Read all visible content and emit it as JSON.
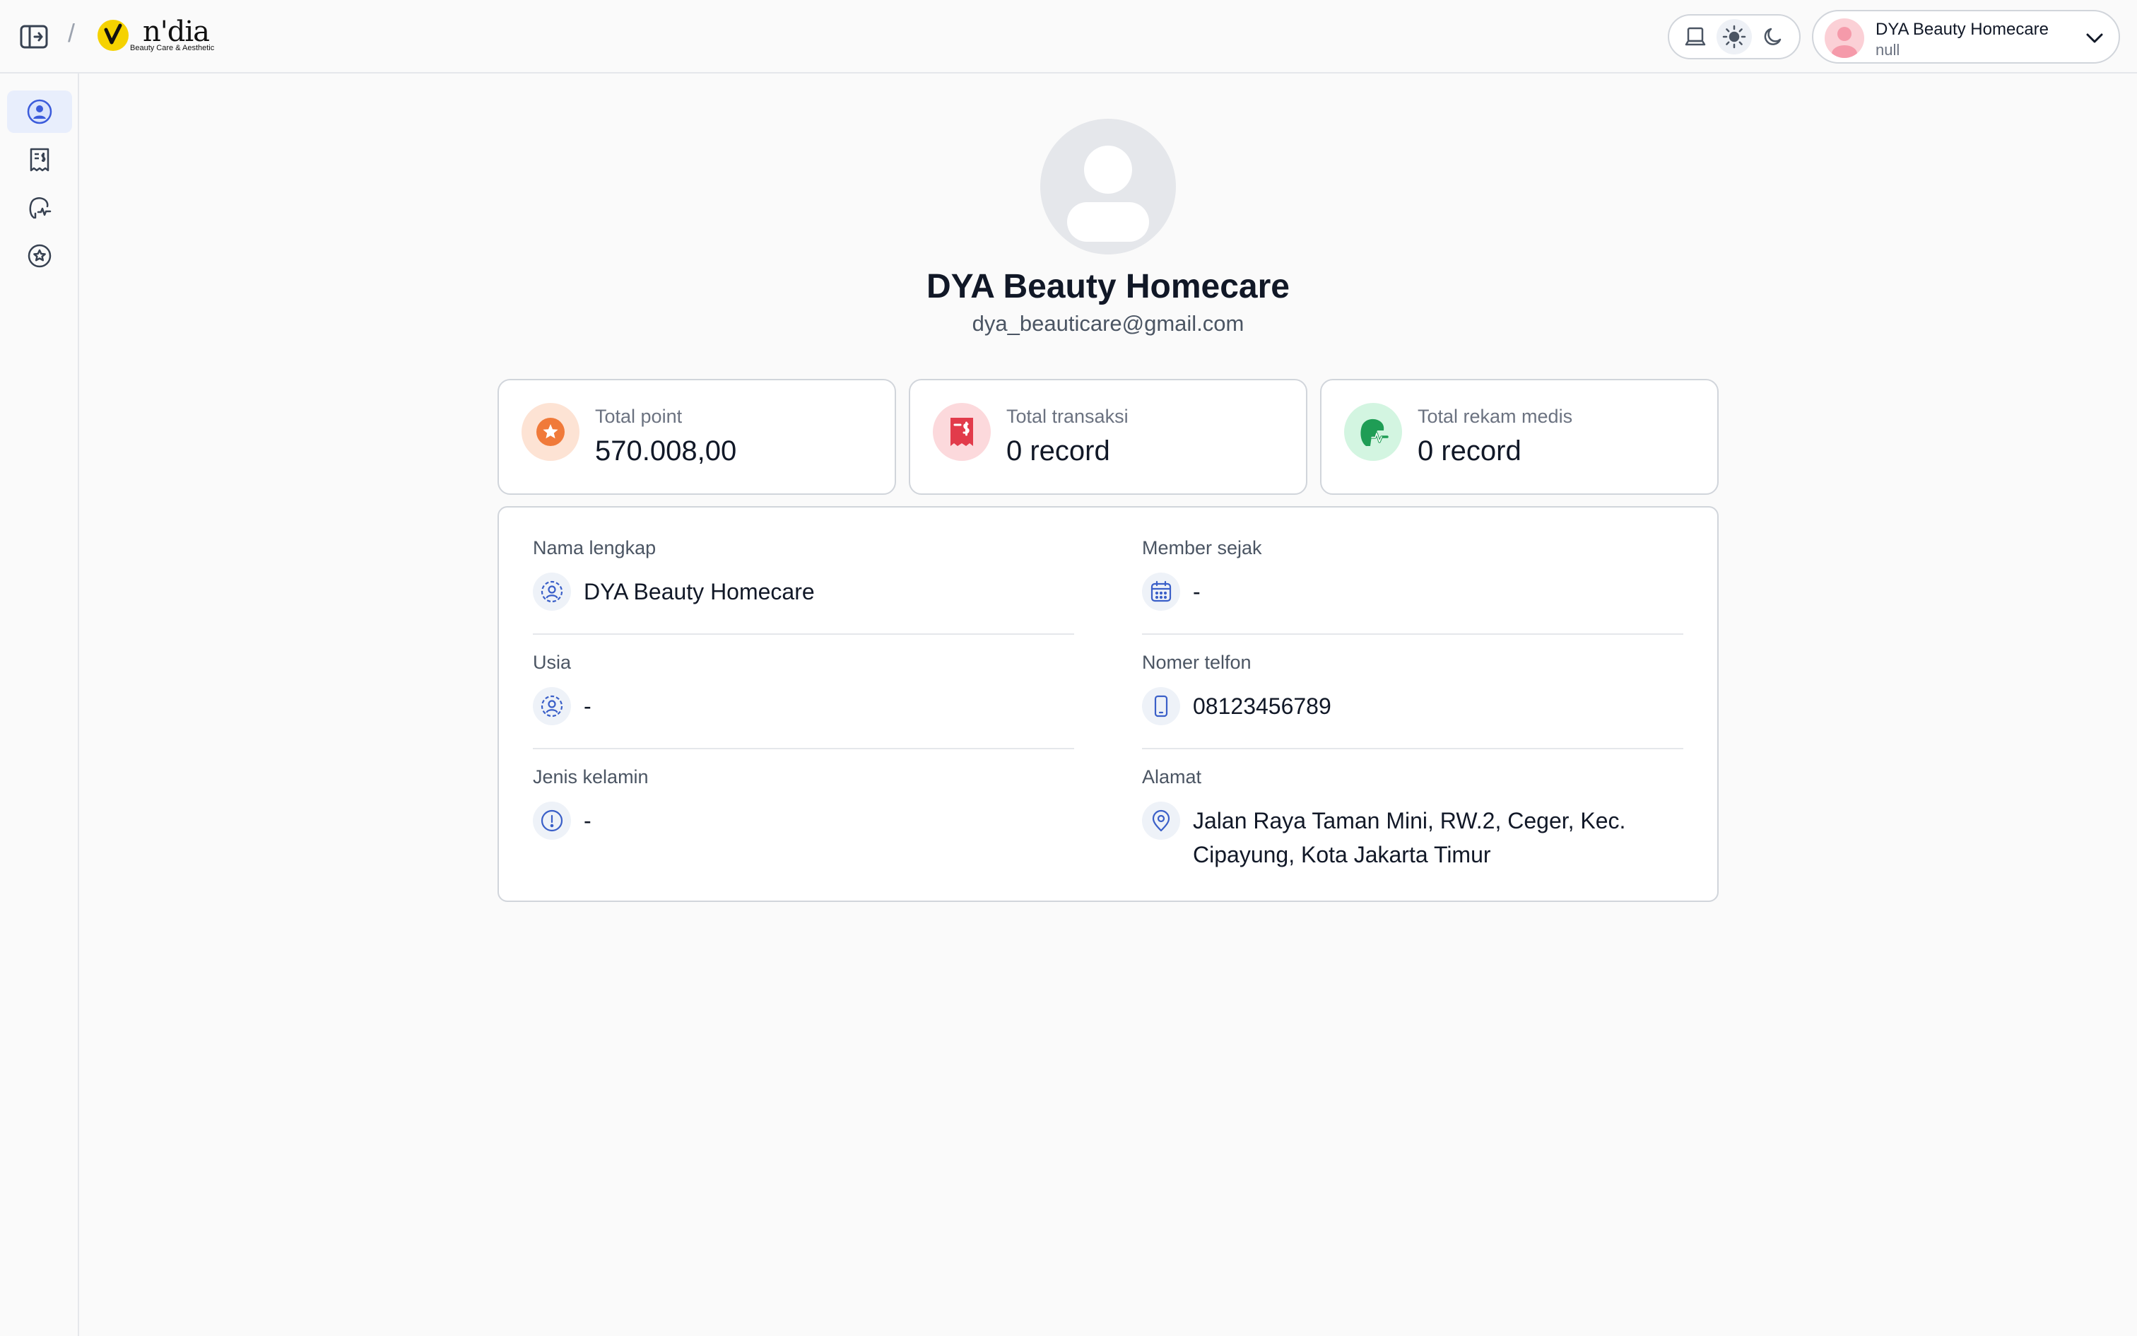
{
  "app": {
    "logo_text": "n'dia",
    "logo_sub": "Beauty Care & Aesthetic",
    "crumb_separator": "/"
  },
  "header": {
    "theme_modes": [
      "system",
      "light",
      "dark"
    ],
    "active_theme": "light",
    "user": {
      "name": "DYA Beauty Homecare",
      "role": "null"
    }
  },
  "sidebar": {
    "items": [
      {
        "icon": "user-circle-icon",
        "active": true
      },
      {
        "icon": "receipt-icon",
        "active": false
      },
      {
        "icon": "medical-record-icon",
        "active": false
      },
      {
        "icon": "star-badge-icon",
        "active": false
      }
    ]
  },
  "profile": {
    "name": "DYA Beauty Homecare",
    "email": "dya_beauticare@gmail.com"
  },
  "stats": [
    {
      "label": "Total point",
      "value": "570.008,00",
      "icon": "star-icon",
      "color": "#f07a3a",
      "bg": "#fde3d4"
    },
    {
      "label": "Total transaksi",
      "value": "0 record",
      "icon": "receipt-dollar-icon",
      "color": "#e23b4b",
      "bg": "#fcd9dc"
    },
    {
      "label": "Total rekam medis",
      "value": "0 record",
      "icon": "medical-record-icon",
      "color": "#1f9d55",
      "bg": "#d3f5e1"
    }
  ],
  "details": {
    "full_name": {
      "label": "Nama lengkap",
      "value": "DYA Beauty Homecare"
    },
    "member_since": {
      "label": "Member sejak",
      "value": "-"
    },
    "age": {
      "label": "Usia",
      "value": "-"
    },
    "phone": {
      "label": "Nomer telfon",
      "value": "08123456789"
    },
    "gender": {
      "label": "Jenis kelamin",
      "value": "-"
    },
    "address": {
      "label": "Alamat",
      "value": "Jalan Raya Taman Mini, RW.2, Ceger, Kec. Cipayung, Kota Jakarta Timur"
    }
  },
  "colors": {
    "accent": "#3b5bdb",
    "icon_blue": "#3a5fc8",
    "border": "#d1d5db"
  }
}
